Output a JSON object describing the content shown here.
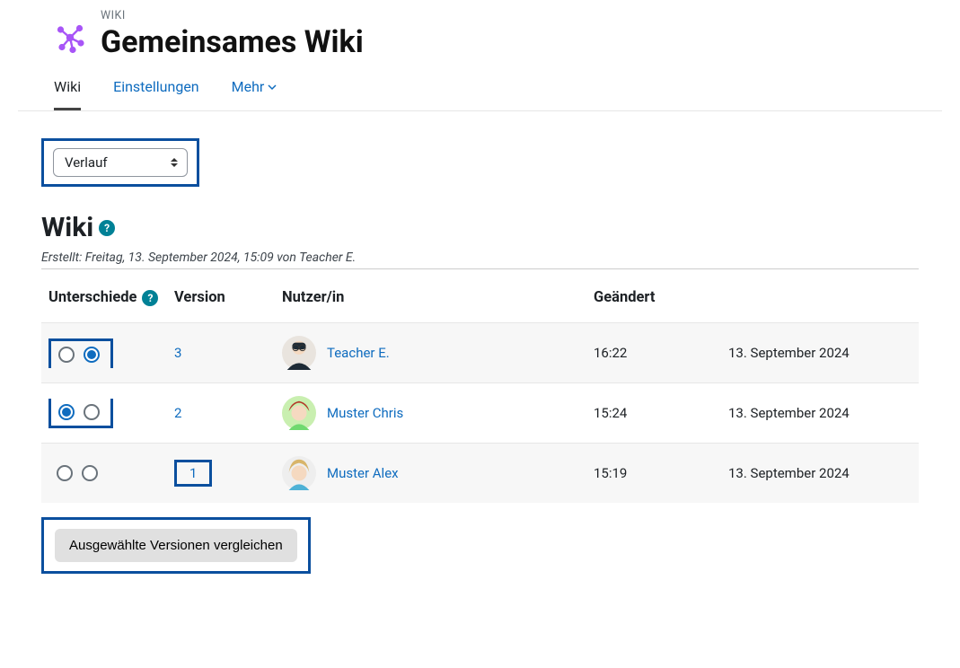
{
  "breadcrumb": "WIKI",
  "title": "Gemeinsames Wiki",
  "tabs": {
    "wiki": "Wiki",
    "settings": "Einstellungen",
    "more": "Mehr"
  },
  "view_select": "Verlauf",
  "wiki_heading": "Wiki",
  "help_char": "?",
  "created_line": "Erstellt: Freitag, 13. September 2024, 15:09 von Teacher E.",
  "columns": {
    "diffs": "Unterschiede",
    "version": "Version",
    "user": "Nutzer/in",
    "changed": "Geändert"
  },
  "rows": [
    {
      "version": "3",
      "user": "Teacher E.",
      "time": "16:22",
      "date": "13. September 2024",
      "sel_a": false,
      "sel_b": true
    },
    {
      "version": "2",
      "user": "Muster Chris",
      "time": "15:24",
      "date": "13. September 2024",
      "sel_a": true,
      "sel_b": false
    },
    {
      "version": "1",
      "user": "Muster Alex",
      "time": "15:19",
      "date": "13. September 2024",
      "sel_a": false,
      "sel_b": false
    }
  ],
  "compare_label": "Ausgewählte Versionen vergleichen",
  "colors": {
    "link": "#0f6cbf",
    "highlight": "#0b4f9e",
    "help": "#008196"
  }
}
